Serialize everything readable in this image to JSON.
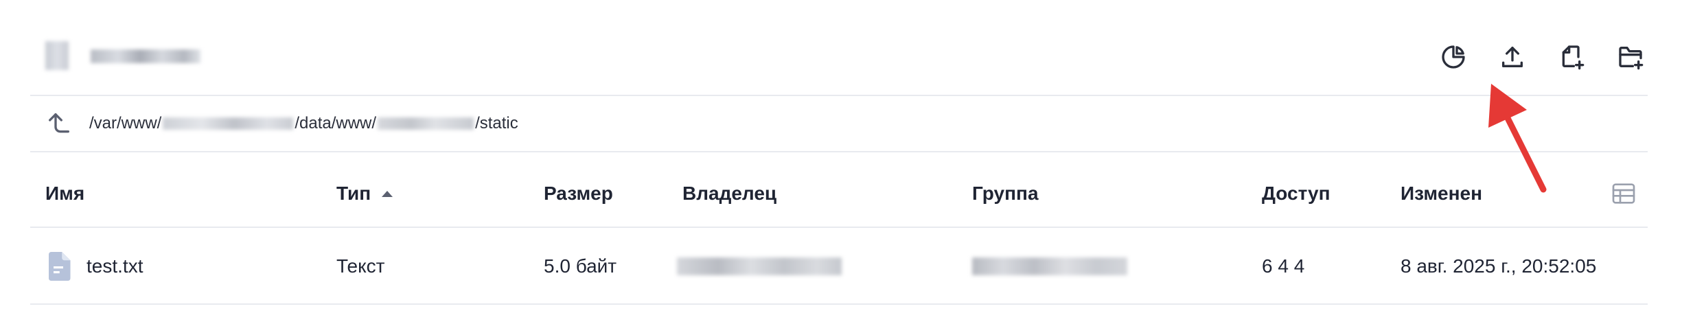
{
  "toolbar": {
    "icons": [
      "pie-chart-icon",
      "upload-icon",
      "new-file-icon",
      "new-folder-icon"
    ]
  },
  "path": {
    "prefix": "/var/www/",
    "middle": "/data/www/",
    "suffix": "/static"
  },
  "table": {
    "headers": {
      "name": "Имя",
      "type": "Тип",
      "size": "Размер",
      "owner": "Владелец",
      "group": "Группа",
      "access": "Доступ",
      "modified": "Изменен"
    },
    "rows": [
      {
        "name": "test.txt",
        "type": "Текст",
        "size": "5.0 байт",
        "access": "6 4 4",
        "modified": "8 авг. 2025 г., 20:52:05"
      }
    ]
  },
  "colors": {
    "icon": "#2a2e3a",
    "muted_icon": "#9aa0ad",
    "file_icon": "#b6c2da",
    "annotation_arrow": "#e53935",
    "divider": "#e8eaef"
  }
}
